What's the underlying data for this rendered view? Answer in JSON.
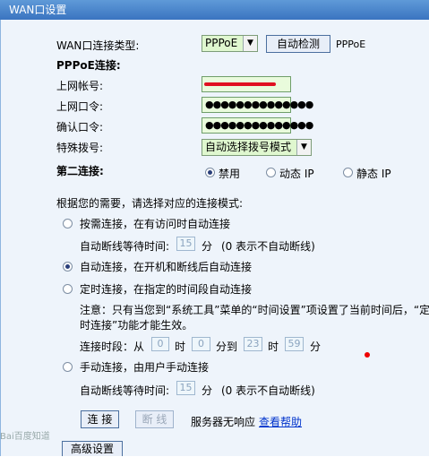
{
  "window_title": "WAN口设置",
  "wan_type": {
    "label": "WAN口连接类型:",
    "selected": "PPPoE",
    "detect_button": "自动检测",
    "detected": "PPPoE"
  },
  "pppoe_section": "PPPoE连接:",
  "account": {
    "label": "上网帐号:"
  },
  "password": {
    "label": "上网口令:",
    "value": "●●●●●●●●●●●●●●"
  },
  "confirm": {
    "label": "确认口令:",
    "value": "●●●●●●●●●●●●●●"
  },
  "dial": {
    "label": "特殊拨号:",
    "selected": "自动选择拨号模式"
  },
  "second": {
    "label": "第二连接:",
    "options": [
      "禁用",
      "动态 IP",
      "静态 IP"
    ]
  },
  "mode_prompt": "根据您的需要，请选择对应的连接模式:",
  "modes": {
    "on_demand": "按需连接，在有访问时自动连接",
    "idle1_label": "自动断线等待时间:",
    "idle1_value": "15",
    "idle_unit": "分",
    "idle_note": "(0 表示不自动断线)",
    "auto": "自动连接，在开机和断线后自动连接",
    "timed": "定时连接，在指定的时间段自动连接",
    "note_line1": "注意：只有当您到“系统工具”菜单的“时间设置”项设置了当前时间后，“定",
    "note_line2": "时连接”功能才能生效。",
    "period_label": "连接时段：从",
    "period_h1": "0",
    "period_m1": "0",
    "period_to": "分到",
    "period_h2": "23",
    "period_m2": "59",
    "hour": "时",
    "manual": "手动连接，由用户手动连接",
    "idle2_label": "自动断线等待时间:",
    "idle2_value": "15"
  },
  "buttons": {
    "connect": "连 接",
    "disconnect": "断 线",
    "status": "服务器无响应",
    "help": "查看帮助",
    "advanced": "高级设置"
  },
  "watermark": "Bai百度知道"
}
